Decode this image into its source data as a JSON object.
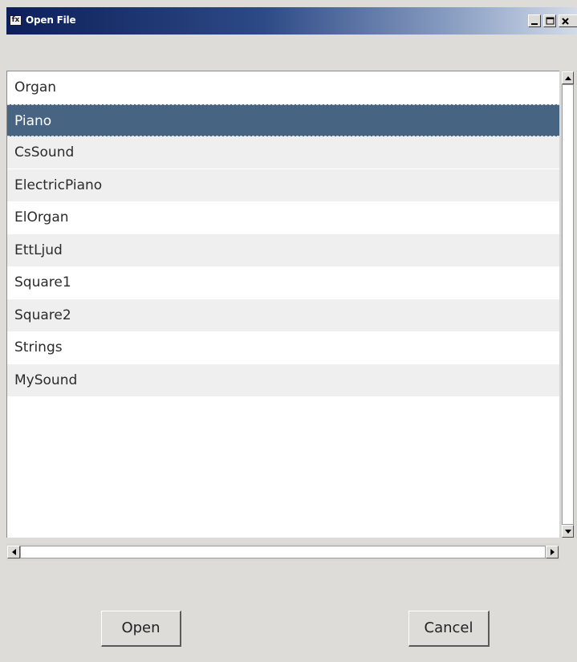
{
  "window": {
    "title": "Open File",
    "icon_glyph": "fx",
    "controls": {
      "minimize_icon": "minimize-icon",
      "maximize_icon": "maximize-icon",
      "close_icon": "close-icon"
    },
    "titlebar_gradient": [
      "#0d1f5a",
      "#2d4a86",
      "#8fa3c6",
      "#d3dbe9"
    ]
  },
  "file_list": {
    "selected_index": 1,
    "selected_color": "#476583",
    "items": [
      {
        "label": "Organ"
      },
      {
        "label": "Piano"
      },
      {
        "label": "CsSound"
      },
      {
        "label": "ElectricPiano"
      },
      {
        "label": "ElOrgan"
      },
      {
        "label": "EttLjud"
      },
      {
        "label": "Square1"
      },
      {
        "label": "Square2"
      },
      {
        "label": "Strings"
      },
      {
        "label": "MySound"
      }
    ]
  },
  "scrollbars": {
    "vertical": {
      "up_icon": "arrow-up-icon",
      "down_icon": "arrow-down-icon"
    },
    "horizontal": {
      "left_icon": "arrow-left-icon",
      "right_icon": "arrow-right-icon"
    }
  },
  "buttons": {
    "open_label": "Open",
    "cancel_label": "Cancel"
  }
}
